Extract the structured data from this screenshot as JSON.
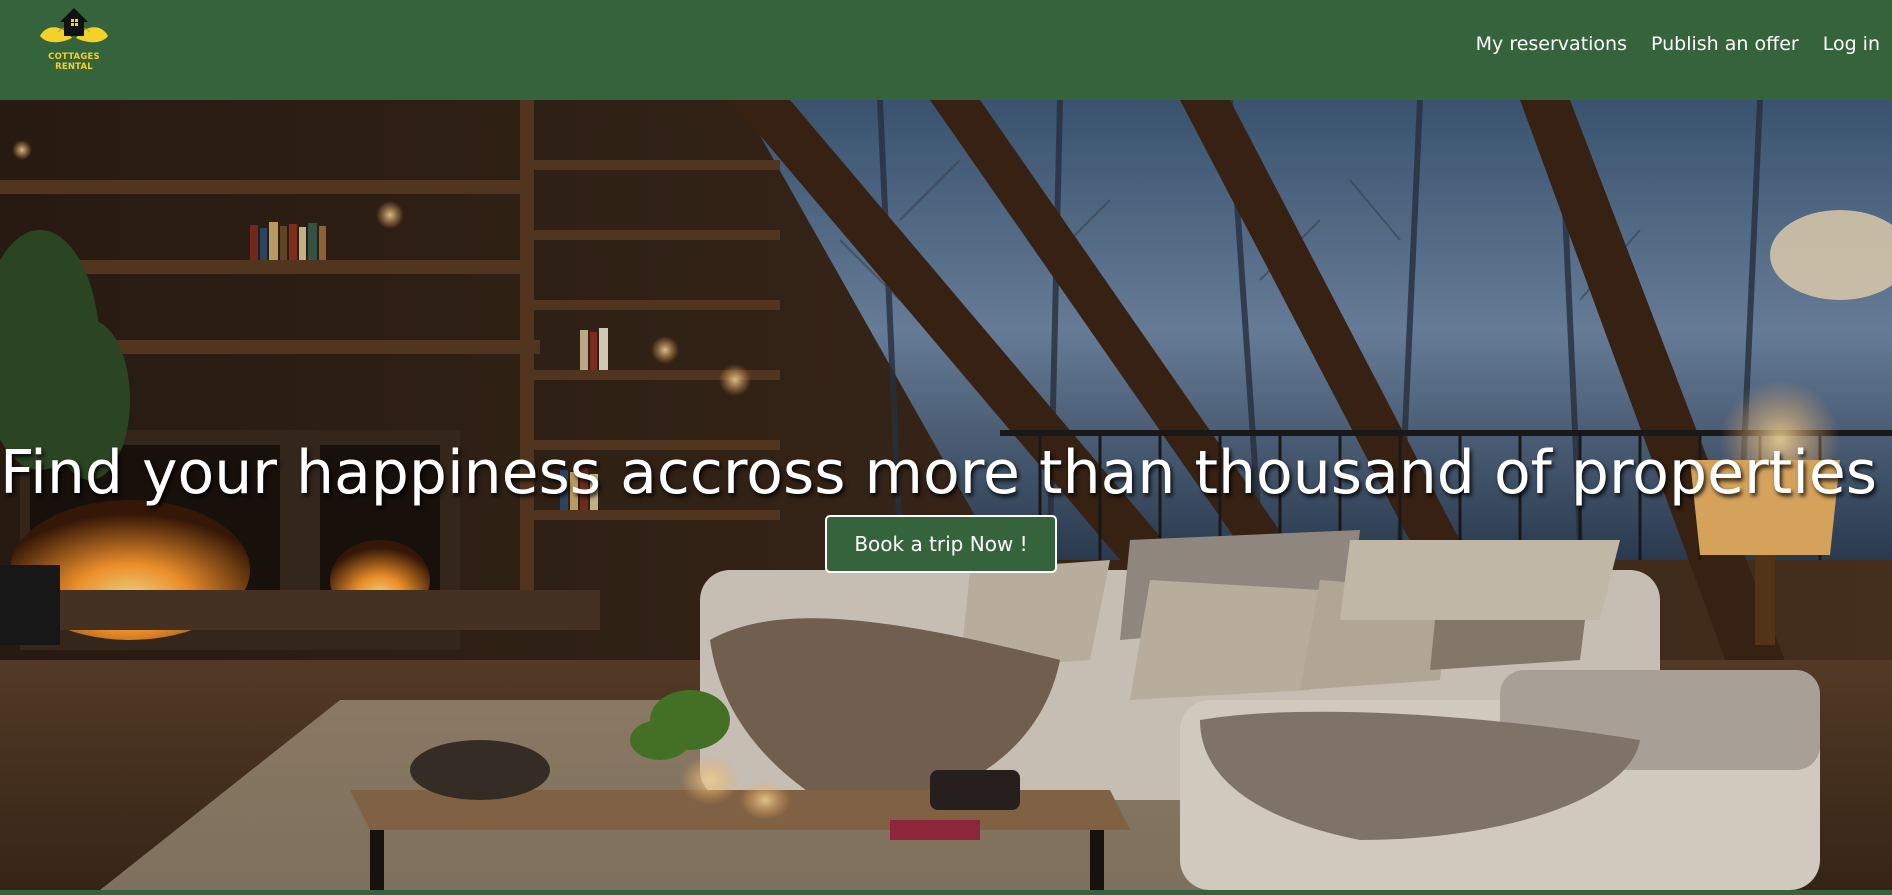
{
  "header": {
    "logo": {
      "line1": "COTTAGES",
      "line2": "RENTAL",
      "icon": "house-leaf-logo-icon"
    },
    "nav": [
      {
        "label": "My reservations"
      },
      {
        "label": "Publish an offer"
      },
      {
        "label": "Log in"
      }
    ]
  },
  "hero": {
    "title": "Find your happiness accross more than thousand of properties !",
    "cta_label": "Book a trip Now !",
    "background": "cozy-cabin-living-room-image"
  },
  "colors": {
    "brand_green": "#35633c",
    "logo_yellow": "#f2d12a",
    "text_white": "#ffffff"
  }
}
